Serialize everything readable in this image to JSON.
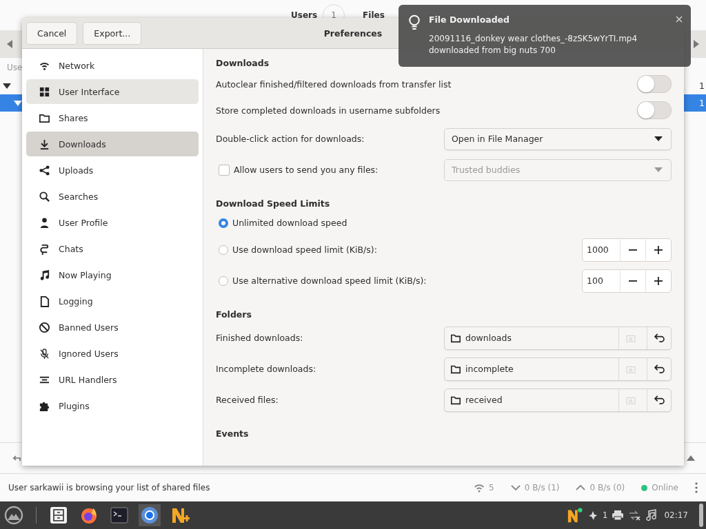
{
  "app": {
    "counters": [
      {
        "label": "Users",
        "value": "1"
      },
      {
        "label": "Files"
      }
    ],
    "list_header": "Use",
    "rows": [
      {
        "selected": false,
        "value": "1"
      },
      {
        "selected": true,
        "value": "1"
      }
    ]
  },
  "dialog": {
    "title": "Preferences",
    "left_buttons": [
      "Cancel",
      "Export..."
    ],
    "sidebar": [
      {
        "label": "Network",
        "selected": false,
        "hovered": false
      },
      {
        "label": "User Interface",
        "selected": false,
        "hovered": true
      },
      {
        "label": "Shares",
        "selected": false,
        "hovered": false
      },
      {
        "label": "Downloads",
        "selected": true,
        "hovered": false
      },
      {
        "label": "Uploads",
        "selected": false,
        "hovered": false
      },
      {
        "label": "Searches",
        "selected": false,
        "hovered": false
      },
      {
        "label": "User Profile",
        "selected": false,
        "hovered": false
      },
      {
        "label": "Chats",
        "selected": false,
        "hovered": false
      },
      {
        "label": "Now Playing",
        "selected": false,
        "hovered": false
      },
      {
        "label": "Logging",
        "selected": false,
        "hovered": false
      },
      {
        "label": "Banned Users",
        "selected": false,
        "hovered": false
      },
      {
        "label": "Ignored Users",
        "selected": false,
        "hovered": false
      },
      {
        "label": "URL Handlers",
        "selected": false,
        "hovered": false
      },
      {
        "label": "Plugins",
        "selected": false,
        "hovered": false
      }
    ],
    "rows": [
      {
        "kind": "section",
        "label": "Downloads"
      },
      {
        "kind": "toggle",
        "label": "Autoclear finished/filtered downloads from transfer list",
        "on": false
      },
      {
        "kind": "toggle",
        "label": "Store completed downloads in username subfolders",
        "on": false
      },
      {
        "kind": "dropdown",
        "label": "Double-click action for downloads:",
        "value": "Open in File Manager",
        "disabled": false
      },
      {
        "kind": "check-dropdown",
        "label": "Allow users to send you any files:",
        "checked": false,
        "value": "Trusted buddies",
        "disabled": true
      },
      {
        "kind": "section",
        "label": "Download Speed Limits"
      },
      {
        "kind": "radio",
        "label": "Unlimited download speed",
        "selected": true
      },
      {
        "kind": "radio-spin",
        "label": "Use download speed limit (KiB/s):",
        "selected": false,
        "value": "1000"
      },
      {
        "kind": "radio-spin",
        "label": "Use alternative download speed limit (KiB/s):",
        "selected": false,
        "value": "100"
      },
      {
        "kind": "section",
        "label": "Folders"
      },
      {
        "kind": "folder",
        "label": "Finished downloads:",
        "value": "downloads"
      },
      {
        "kind": "folder",
        "label": "Incomplete downloads:",
        "value": "incomplete"
      },
      {
        "kind": "folder",
        "label": "Received files:",
        "value": "received"
      },
      {
        "kind": "section",
        "label": "Events"
      }
    ]
  },
  "notification": {
    "title": "File Downloaded",
    "body": "20091116_donkey wear clothes_-8zSK5wYrTI.mp4 downloaded from big nuts 700"
  },
  "status_bar": {
    "message": "User sarkawii is browsing your list of shared files",
    "users": "5",
    "download": "0 B/s (1)",
    "upload": "0 B/s (0)",
    "status": {
      "label": "Online",
      "color": "#2ec27e"
    }
  },
  "taskbar": {
    "notifications": "1",
    "clock": "02:17"
  }
}
